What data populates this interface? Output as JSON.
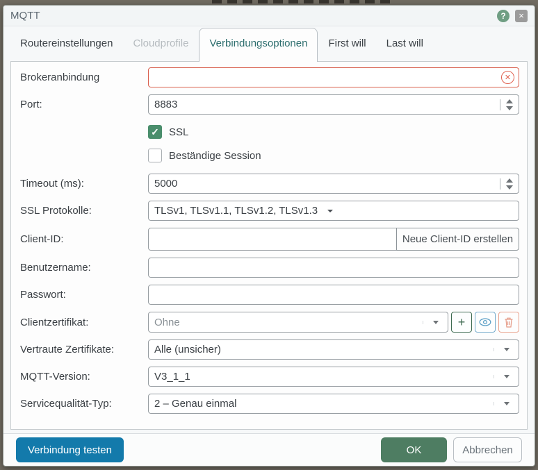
{
  "dialog": {
    "title": "MQTT",
    "icons": {
      "help_glyph": "?",
      "close_glyph": "×",
      "clear_glyph": "✕",
      "check_glyph": "✓",
      "add_glyph": "+"
    }
  },
  "tabs": [
    {
      "label": "Routereinstellungen",
      "active": false,
      "disabled": false
    },
    {
      "label": "Cloudprofile",
      "active": false,
      "disabled": true
    },
    {
      "label": "Verbindungsoptionen",
      "active": true,
      "disabled": false
    },
    {
      "label": "First will",
      "active": false,
      "disabled": false
    },
    {
      "label": "Last will",
      "active": false,
      "disabled": false
    }
  ],
  "form": {
    "broker": {
      "label": "Brokeranbindung",
      "value": "",
      "state": "error"
    },
    "port": {
      "label": "Port:",
      "value": "8883"
    },
    "ssl": {
      "label": "SSL",
      "checked": true
    },
    "session": {
      "label": "Beständige Session",
      "checked": false
    },
    "timeout": {
      "label": "Timeout (ms):",
      "value": "5000"
    },
    "protocols": {
      "label": "SSL Protokolle:",
      "value": "TLSv1, TLSv1.1, TLSv1.2, TLSv1.3"
    },
    "client_id": {
      "label": "Client-ID:",
      "value": "",
      "button": "Neue Client-ID erstellen"
    },
    "username": {
      "label": "Benutzername:",
      "value": ""
    },
    "password": {
      "label": "Passwort:",
      "value": ""
    },
    "client_cert": {
      "label": "Clientzertifikat:",
      "value": "Ohne"
    },
    "trusted_certs": {
      "label": "Vertraute Zertifikate:",
      "value": "Alle (unsicher)"
    },
    "mqtt_version": {
      "label": "MQTT-Version:",
      "value": "V3_1_1"
    },
    "qos": {
      "label": "Servicequalität-Typ:",
      "value": "2 – Genau einmal"
    }
  },
  "footer": {
    "test_button": "Verbindung testen",
    "ok_button": "OK",
    "cancel_button": "Abbrechen"
  },
  "colors": {
    "error_red": "#d9604e",
    "checkbox_green": "#4a8e6c",
    "active_tab_teal": "#2d6e6e",
    "test_button_blue": "#137aab",
    "ok_button_green": "#4e7d62",
    "help_icon_green": "#6f9e83",
    "add_button_green": "#3e6b51",
    "view_button_blue": "#74aacb",
    "delete_button_salmon": "#e9a28d"
  }
}
